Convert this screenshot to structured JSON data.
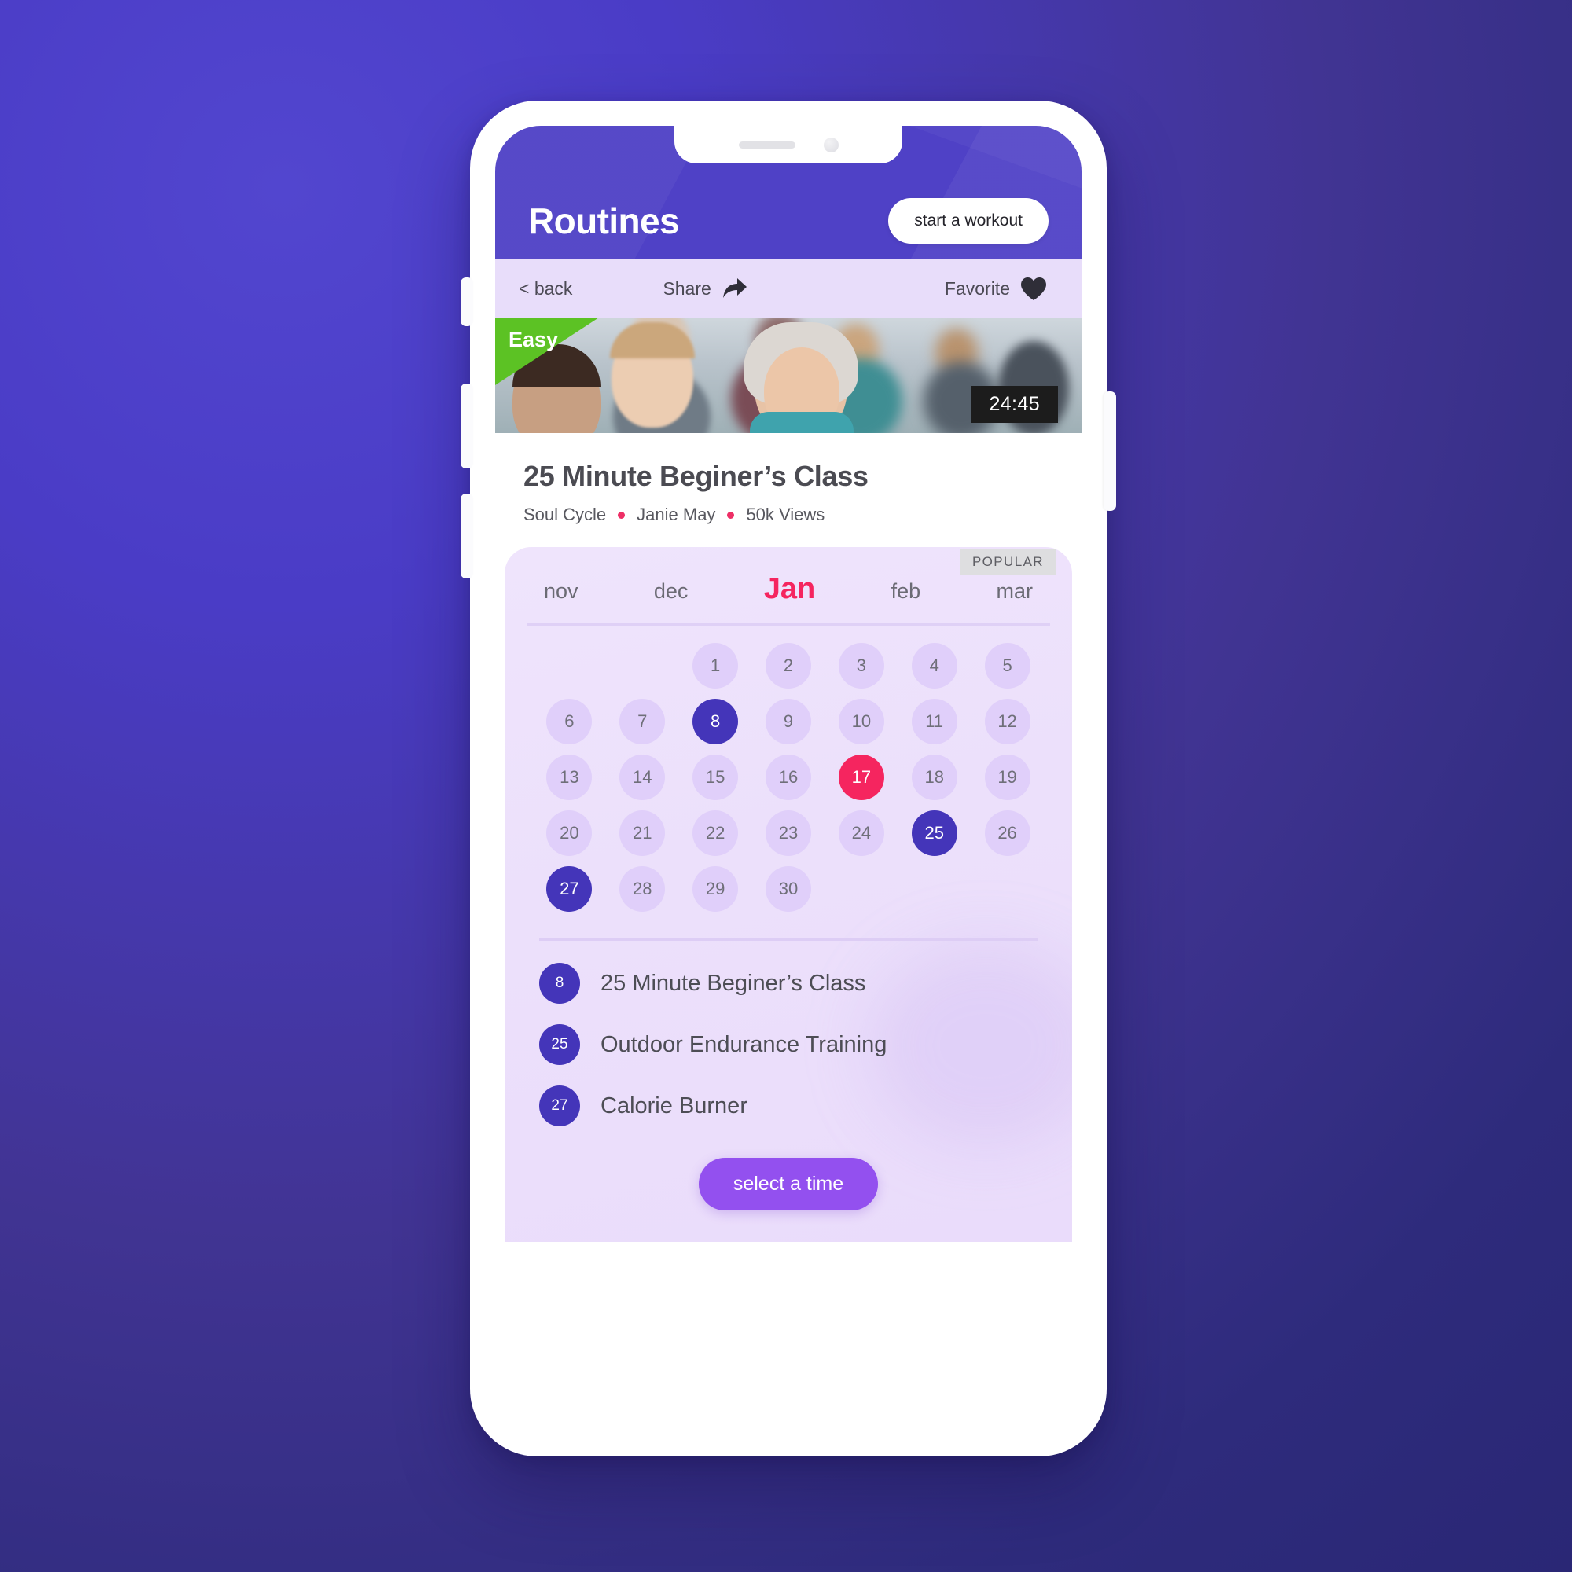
{
  "app": {
    "title": "Routines",
    "start_workout_label": "start a workout",
    "header_color": "#4f41c6"
  },
  "action_bar": {
    "back_label": "< back",
    "share_label": "Share",
    "share_icon": "share-arrow-icon",
    "favorite_label": "Favorite",
    "favorite_icon": "heart-icon"
  },
  "hero": {
    "difficulty_label": "Easy",
    "difficulty_color": "#5cc224",
    "duration": "24:45",
    "popular_label": "POPULAR"
  },
  "detail": {
    "title": "25 Minute Beginer’s Class",
    "studio": "Soul Cycle",
    "instructor": "Janie May",
    "views": "50k Views",
    "dot_color": "#ee2f66"
  },
  "calendar": {
    "months": [
      {
        "label": "nov",
        "active": false
      },
      {
        "label": "dec",
        "active": false
      },
      {
        "label": "Jan",
        "active": true
      },
      {
        "label": "feb",
        "active": false
      },
      {
        "label": "mar",
        "active": false
      }
    ],
    "active_month_color": "#f5255f",
    "leading_blanks": 2,
    "days": [
      {
        "n": "1",
        "state": ""
      },
      {
        "n": "2",
        "state": ""
      },
      {
        "n": "3",
        "state": ""
      },
      {
        "n": "4",
        "state": ""
      },
      {
        "n": "5",
        "state": ""
      },
      {
        "n": "6",
        "state": ""
      },
      {
        "n": "7",
        "state": ""
      },
      {
        "n": "8",
        "state": "booked"
      },
      {
        "n": "9",
        "state": ""
      },
      {
        "n": "10",
        "state": ""
      },
      {
        "n": "11",
        "state": ""
      },
      {
        "n": "12",
        "state": ""
      },
      {
        "n": "13",
        "state": ""
      },
      {
        "n": "14",
        "state": ""
      },
      {
        "n": "15",
        "state": ""
      },
      {
        "n": "16",
        "state": ""
      },
      {
        "n": "17",
        "state": "today"
      },
      {
        "n": "18",
        "state": ""
      },
      {
        "n": "19",
        "state": ""
      },
      {
        "n": "20",
        "state": ""
      },
      {
        "n": "21",
        "state": ""
      },
      {
        "n": "22",
        "state": ""
      },
      {
        "n": "23",
        "state": ""
      },
      {
        "n": "24",
        "state": ""
      },
      {
        "n": "25",
        "state": "booked"
      },
      {
        "n": "26",
        "state": ""
      },
      {
        "n": "27",
        "state": "booked"
      },
      {
        "n": "28",
        "state": ""
      },
      {
        "n": "29",
        "state": ""
      },
      {
        "n": "30",
        "state": ""
      }
    ],
    "booked_color": "#4435b9",
    "today_color": "#f5255f"
  },
  "events": [
    {
      "day": "8",
      "name": "25 Minute Beginer’s Class"
    },
    {
      "day": "25",
      "name": "Outdoor Endurance Training"
    },
    {
      "day": "27",
      "name": "Calorie Burner"
    }
  ],
  "footer": {
    "select_time_label": "select a time",
    "select_time_color": "#9350ef"
  }
}
